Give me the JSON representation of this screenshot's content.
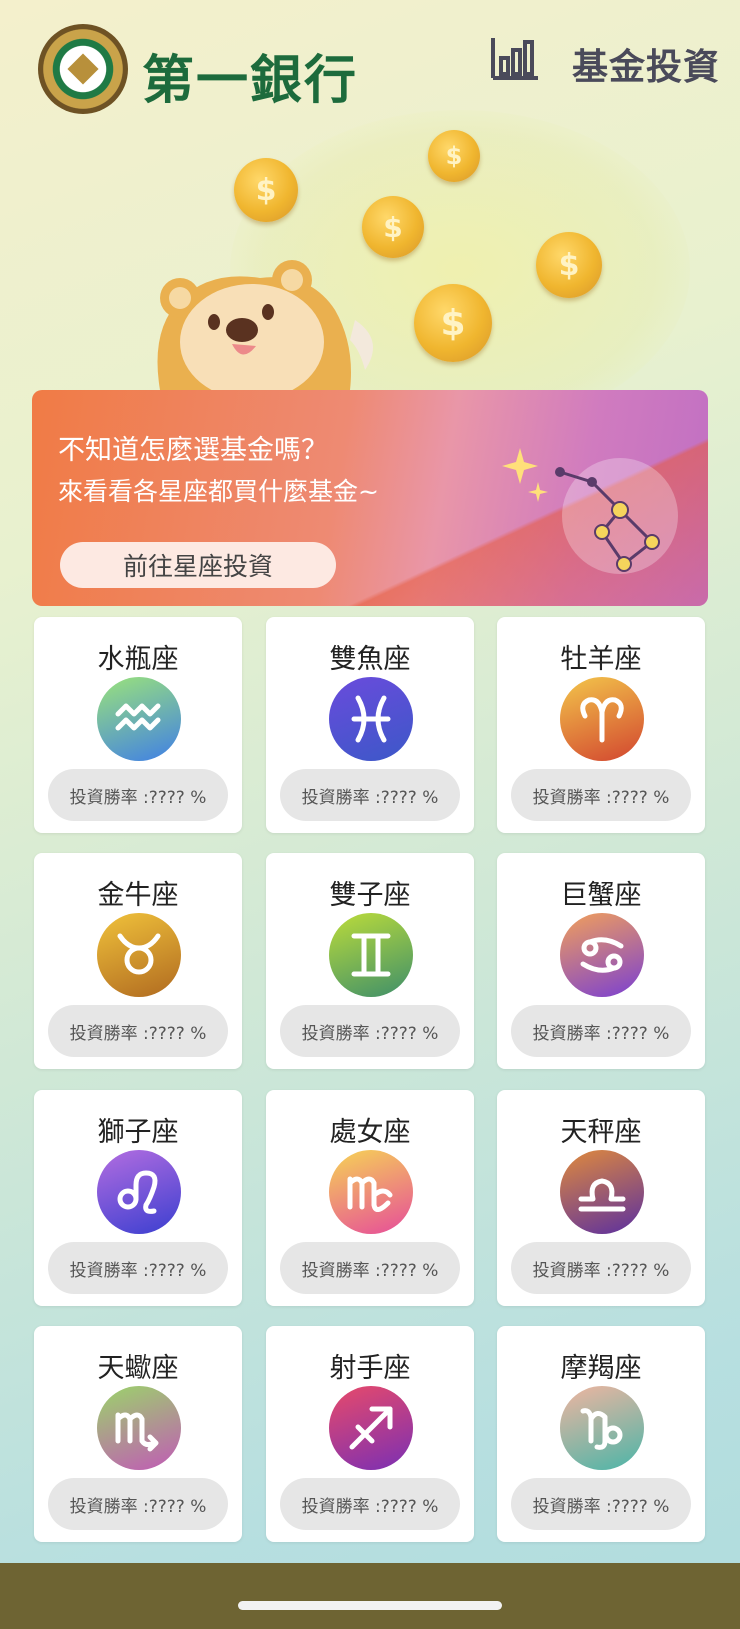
{
  "header": {
    "bank_name": "第一銀行",
    "fund_title": "基金投資",
    "chart_icon": "bar-chart-icon",
    "logo_icon": "first-bank-logo"
  },
  "hero": {
    "coin_symbol": "$",
    "mascot": "lion-mascot"
  },
  "banner": {
    "question": "不知道怎麼選基金嗎？",
    "subtitle": "來看看各星座都買什麼基金~",
    "button_label": "前往星座投資",
    "icon": "constellation-icon"
  },
  "zodiac": [
    {
      "name": "水瓶座",
      "rate": "投資勝率 :????  %",
      "icon": "aquarius-icon"
    },
    {
      "name": "雙魚座",
      "rate": "投資勝率 :????  %",
      "icon": "pisces-icon"
    },
    {
      "name": "牡羊座",
      "rate": "投資勝率 :????  %",
      "icon": "aries-icon"
    },
    {
      "name": "金牛座",
      "rate": "投資勝率 :????  %",
      "icon": "taurus-icon"
    },
    {
      "name": "雙子座",
      "rate": "投資勝率 :????  %",
      "icon": "gemini-icon"
    },
    {
      "name": "巨蟹座",
      "rate": "投資勝率 :????  %",
      "icon": "cancer-icon"
    },
    {
      "name": "獅子座",
      "rate": "投資勝率 :????  %",
      "icon": "leo-icon"
    },
    {
      "name": "處女座",
      "rate": "投資勝率 :????  %",
      "icon": "virgo-icon"
    },
    {
      "name": "天秤座",
      "rate": "投資勝率 :????  %",
      "icon": "libra-icon"
    },
    {
      "name": "天蠍座",
      "rate": "投資勝率 :????  %",
      "icon": "scorpio-icon"
    },
    {
      "name": "射手座",
      "rate": "投資勝率 :????  %",
      "icon": "sagittarius-icon"
    },
    {
      "name": "摩羯座",
      "rate": "投資勝率 :????  %",
      "icon": "capricorn-icon"
    }
  ],
  "colors": {
    "bank_green": "#1d6b3c",
    "coin_gold": "#f0b62f",
    "banner_orange": "#f07b45",
    "banner_purple": "#c06fc3"
  }
}
